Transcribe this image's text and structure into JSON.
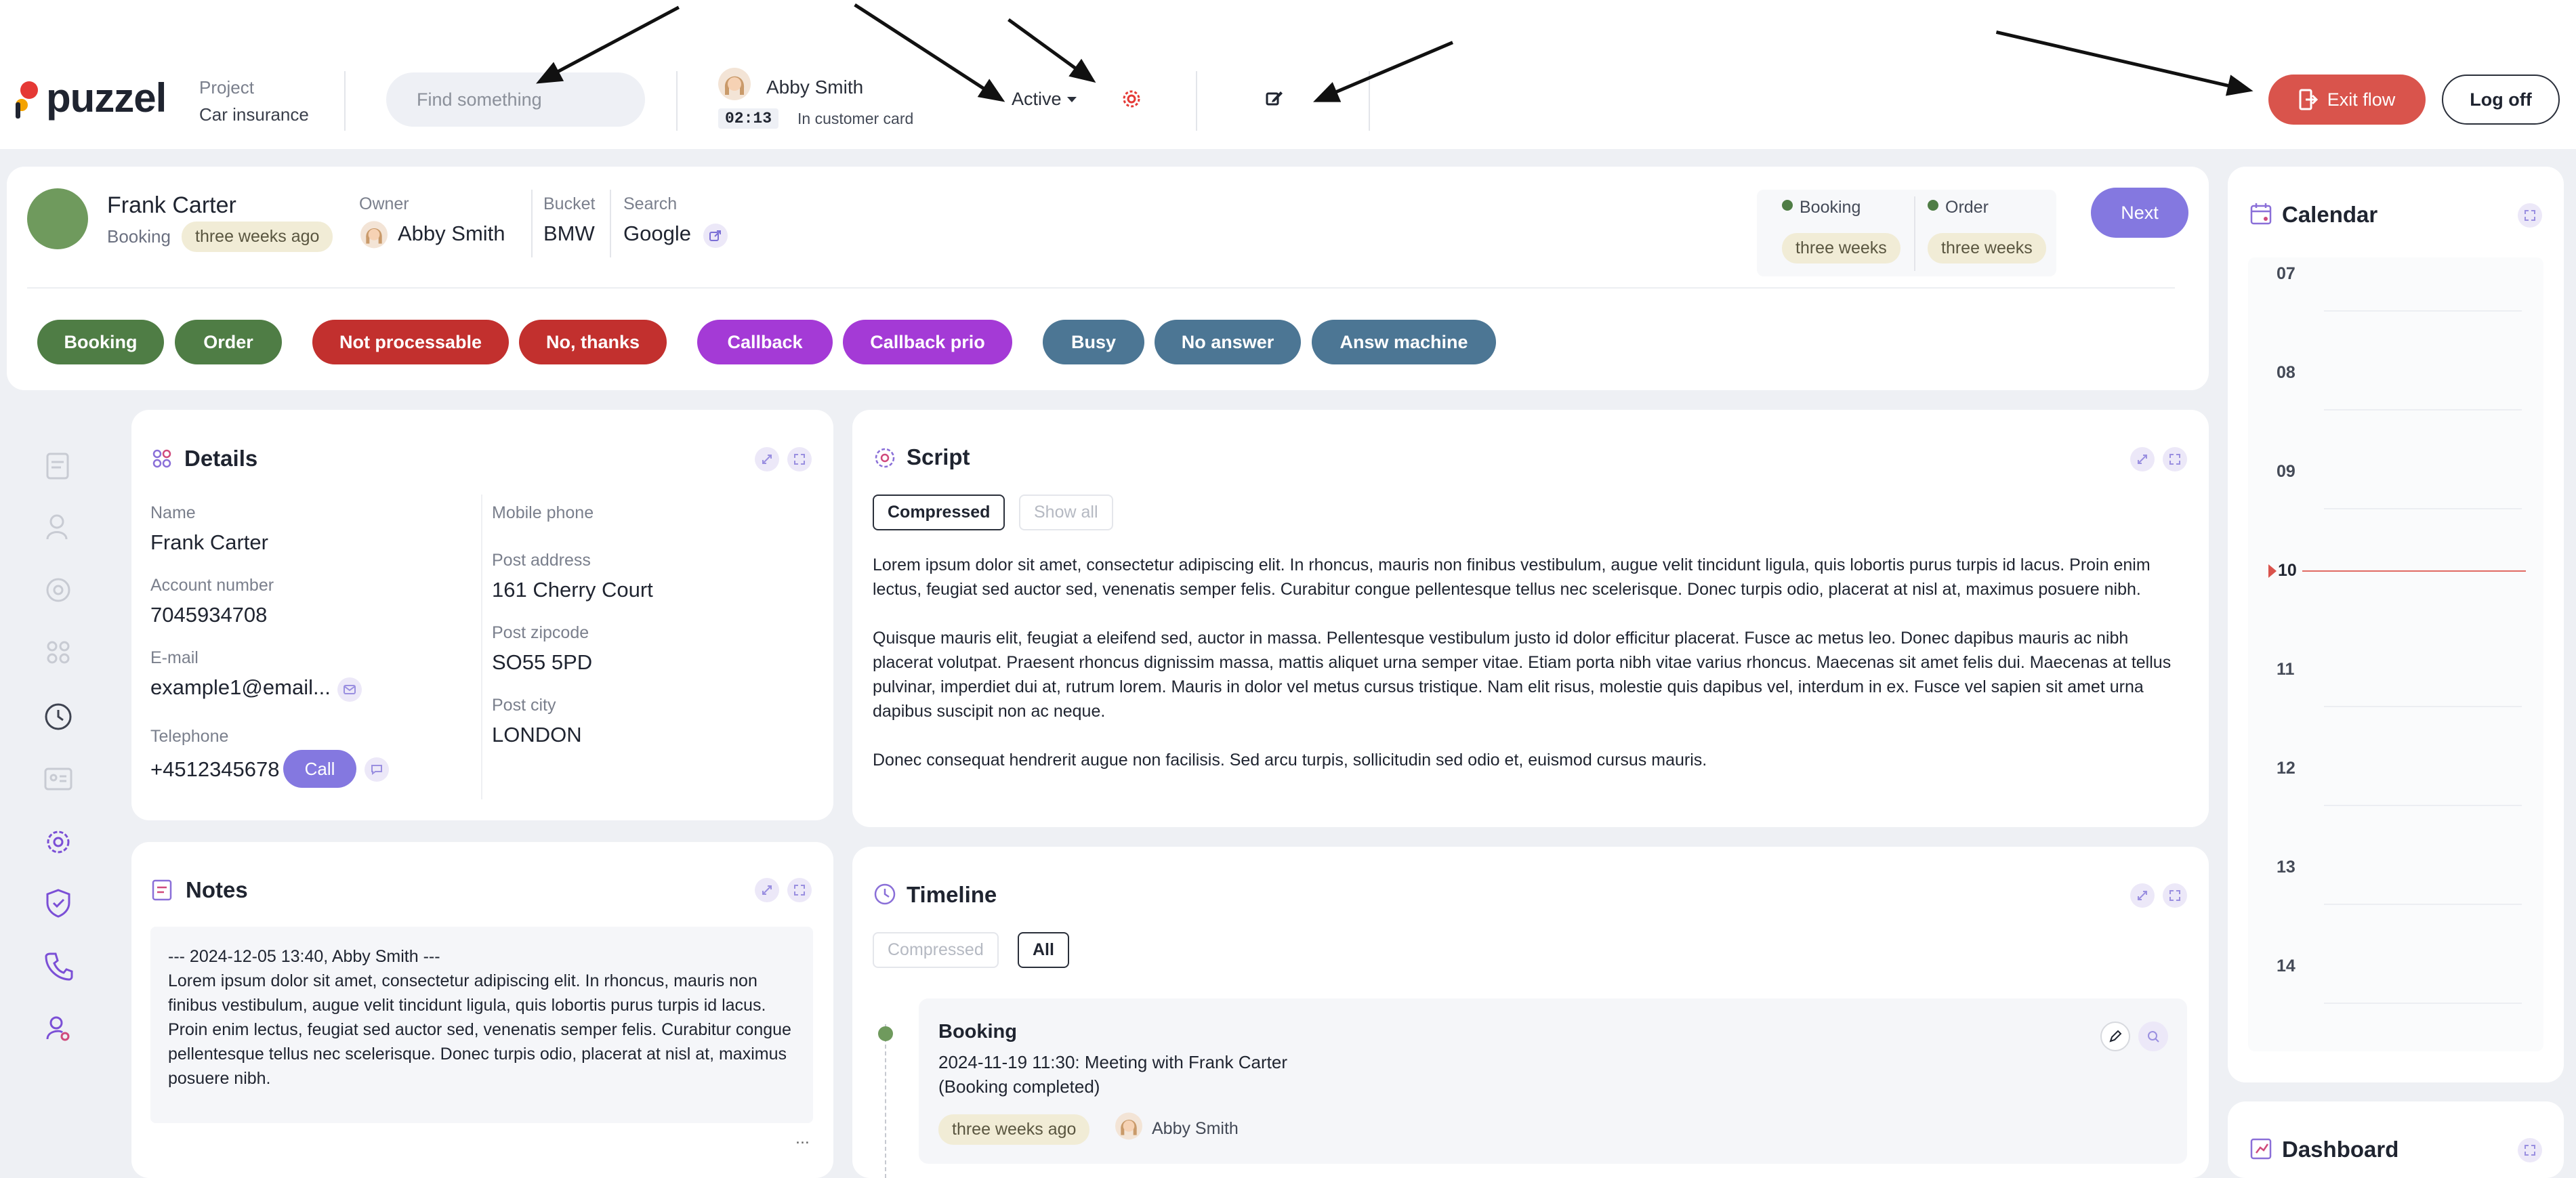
{
  "header": {
    "logo_text": "puzzel",
    "project_label": "Project",
    "project_value": "Car insurance",
    "search_placeholder": "Find something",
    "agent_name": "Abby Smith",
    "timer": "02:13",
    "agent_state": "In customer card",
    "status_label": "Active",
    "exit_flow_label": "Exit flow",
    "logoff_label": "Log off"
  },
  "customer": {
    "name": "Frank Carter",
    "stage": "Booking",
    "stage_age": "three weeks ago",
    "owner_label": "Owner",
    "owner_name": "Abby Smith",
    "bucket_label": "Bucket",
    "bucket_value": "BMW",
    "search_label": "Search",
    "search_value": "Google",
    "stat1_label": "Booking",
    "stat1_value": "three weeks",
    "stat2_label": "Order",
    "stat2_value": "three weeks",
    "next_label": "Next"
  },
  "outcomes": [
    {
      "label": "Booking",
      "color": "#4f7d45"
    },
    {
      "label": "Order",
      "color": "#4f7d45"
    },
    {
      "label": "Not processable",
      "color": "#c2302e"
    },
    {
      "label": "No, thanks",
      "color": "#c2302e"
    },
    {
      "label": "Callback",
      "color": "#a43ad6"
    },
    {
      "label": "Callback prio",
      "color": "#a43ad6"
    },
    {
      "label": "Busy",
      "color": "#4c7694"
    },
    {
      "label": "No answer",
      "color": "#4c7694"
    },
    {
      "label": "Answ machine",
      "color": "#4c7694"
    }
  ],
  "details": {
    "title": "Details",
    "name_label": "Name",
    "name_value": "Frank Carter",
    "account_label": "Account number",
    "account_value": "7045934708",
    "email_label": "E-mail",
    "email_value": "example1@email...",
    "tel_label": "Telephone",
    "tel_value": "+4512345678",
    "call_label": "Call",
    "mobile_label": "Mobile phone",
    "post_address_label": "Post address",
    "post_address_value": "161 Cherry Court",
    "post_zip_label": "Post zipcode",
    "post_zip_value": "SO55 5PD",
    "post_city_label": "Post city",
    "post_city_value": "LONDON"
  },
  "notes": {
    "title": "Notes",
    "header": "--- 2024-12-05 13:40, Abby Smith ---",
    "body": "Lorem ipsum dolor sit amet, consectetur adipiscing elit. In rhoncus, mauris non finibus vestibulum, augue velit tincidunt ligula, quis lobortis purus turpis id lacus. Proin enim lectus, feugiat sed auctor sed, venenatis semper felis. Curabitur congue pellentesque tellus nec scelerisque. Donec turpis odio, placerat at nisl at, maximus posuere nibh.",
    "more": "..."
  },
  "script": {
    "title": "Script",
    "tab_compressed": "Compressed",
    "tab_showall": "Show all",
    "p1": "Lorem ipsum dolor sit amet, consectetur adipiscing elit. In rhoncus, mauris non finibus vestibulum, augue velit tincidunt ligula, quis lobortis purus turpis id lacus. Proin enim lectus, feugiat sed auctor sed, venenatis semper felis. Curabitur congue pellentesque tellus nec scelerisque. Donec turpis odio, placerat at nisl at, maximus posuere nibh.",
    "p2": "Quisque mauris elit, feugiat a eleifend sed, auctor in massa. Pellentesque vestibulum justo id dolor efficitur placerat. Fusce ac metus leo. Donec dapibus mauris ac nibh placerat volutpat. Praesent rhoncus dignissim massa, mattis aliquet urna semper vitae. Etiam porta nibh vitae varius rhoncus. Maecenas sit amet felis dui. Maecenas at tellus pulvinar, imperdiet dui at, rutrum lorem. Mauris in dolor vel metus cursus tristique. Nam elit risus, molestie quis dapibus vel, interdum in ex. Fusce vel sapien sit amet urna dapibus suscipit non ac neque.",
    "p3": "Donec consequat hendrerit augue non facilisis. Sed arcu turpis, sollicitudin sed odio et, euismod cursus mauris."
  },
  "timeline": {
    "title": "Timeline",
    "tab_compressed": "Compressed",
    "tab_all": "All",
    "entry_title": "Booking",
    "entry_line1": "2024-11-19 11:30: Meeting with Frank Carter",
    "entry_line2": "(Booking completed)",
    "entry_age": "three weeks ago",
    "entry_user": "Abby Smith"
  },
  "calendar": {
    "title": "Calendar",
    "hours": [
      "07",
      "08",
      "09",
      "10",
      "11",
      "12",
      "13",
      "14"
    ],
    "current_hour": "10"
  },
  "dashboard": {
    "title": "Dashboard"
  }
}
